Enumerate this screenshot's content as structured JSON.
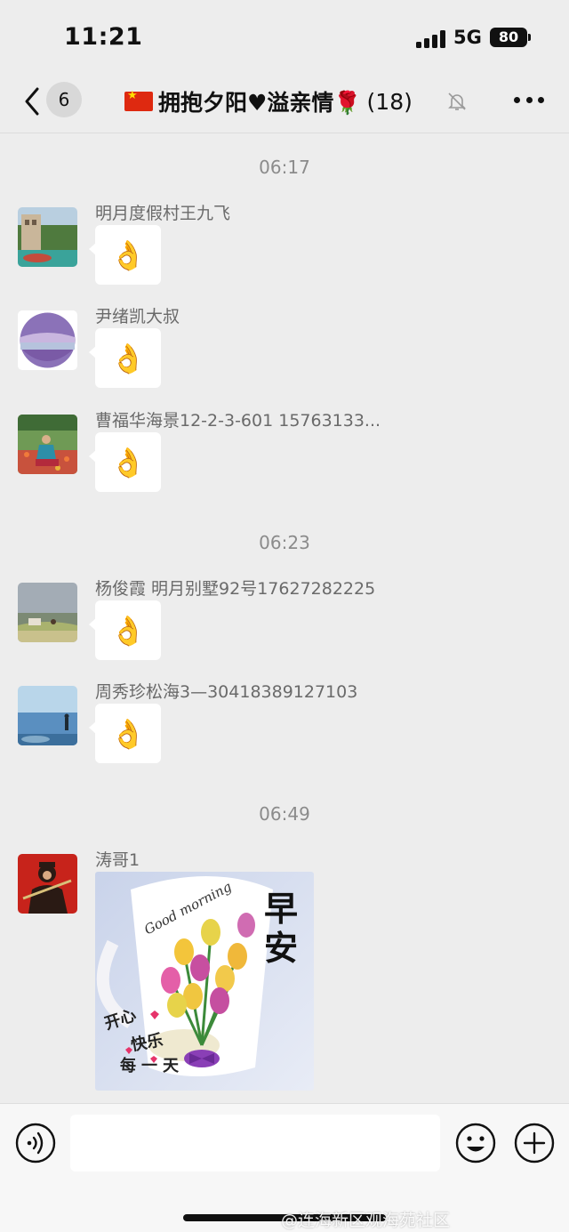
{
  "status_bar": {
    "time": "11:21",
    "network": "5G",
    "battery": "80"
  },
  "header": {
    "unread_count": "6",
    "title": "拥抱夕阳♥溢亲情🌹",
    "member_count": "(18)"
  },
  "timestamps": [
    "06:17",
    "06:23",
    "06:49"
  ],
  "messages": [
    {
      "sender": "明月度假村王九飞",
      "content": "👌"
    },
    {
      "sender": "尹绪凯大叔",
      "content": "👌"
    },
    {
      "sender": "曹福华海景12-2-3-601 15763133...",
      "content": "👌"
    },
    {
      "sender": "杨俊霞 明月别墅92号17627282225",
      "content": "👌"
    },
    {
      "sender": "周秀珍松海3—30418389127103",
      "content": "👌"
    },
    {
      "sender": "涛哥1",
      "image_text": {
        "greeting": "Good morning",
        "big": "早安",
        "line1": "开心",
        "line2": "快乐",
        "line3": "每一天"
      }
    }
  ],
  "input_bar": {
    "placeholder": ""
  },
  "watermark": "@连海新区观海苑社区",
  "colors": {
    "background": "#ededed",
    "bubble": "#ffffff",
    "flag_red": "#de2910"
  }
}
